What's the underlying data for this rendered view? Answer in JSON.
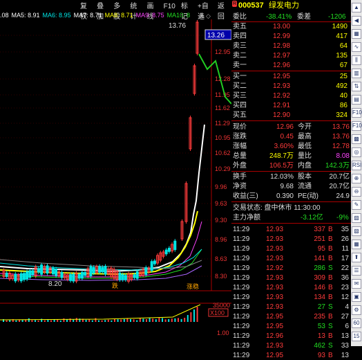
{
  "toolbar": {
    "items": [
      "复权",
      "叠加",
      "多股",
      "统计",
      "画线",
      "F10",
      "标记",
      "+自选",
      "返回"
    ]
  },
  "ma_legend": [
    {
      "label": ".08",
      "color": "#ffffff"
    },
    {
      "label": "MA5: 8.91",
      "color": "#ffffff"
    },
    {
      "label": "MA6: 8.95",
      "color": "#00e5e5"
    },
    {
      "label": "MA7: 8.71",
      "color": "#ffffff"
    },
    {
      "label": "MA8: 8.71",
      "color": "#ffff00"
    },
    {
      "label": "MA9: 8.75",
      "color": "#ff44ff"
    },
    {
      "label": "MA10: 8",
      "color": "#22dd22"
    }
  ],
  "chart": {
    "y_labels": [
      "13.26",
      "12.95",
      "12.28",
      "11.95",
      "11.62",
      "11.29",
      "10.95",
      "10.62",
      "10.29",
      "9.96",
      "9.63",
      "9.30",
      "8.96",
      "8.63",
      "8.30"
    ],
    "high_label": "13.76",
    "current_price_tag": "13.26",
    "low_label": "8.20",
    "event_label_1": "跌",
    "event_label_2": "涨稳",
    "volume_labels": [
      "35000",
      "X100",
      "1.00"
    ],
    "zoom_icons": "⊕ ◇"
  },
  "quote": {
    "code": "000537",
    "name": "绿发电力",
    "r_badge": "R",
    "weibi_label": "委比",
    "weibi_value": "-38.41%",
    "weicha_label": "委差",
    "weicha_value": "-1206",
    "asks": [
      {
        "label": "卖五",
        "price": "13.00",
        "vol": "1490"
      },
      {
        "label": "卖四",
        "price": "12.99",
        "vol": "417"
      },
      {
        "label": "卖三",
        "price": "12.98",
        "vol": "64"
      },
      {
        "label": "卖二",
        "price": "12.97",
        "vol": "135"
      },
      {
        "label": "卖一",
        "price": "12.96",
        "vol": "67"
      }
    ],
    "bids": [
      {
        "label": "买一",
        "price": "12.95",
        "vol": "25"
      },
      {
        "label": "买二",
        "price": "12.93",
        "vol": "492"
      },
      {
        "label": "买三",
        "price": "12.92",
        "vol": "40"
      },
      {
        "label": "买四",
        "price": "12.91",
        "vol": "86"
      },
      {
        "label": "买五",
        "price": "12.90",
        "vol": "324"
      }
    ],
    "stats": [
      {
        "l1": "现价",
        "v1": "12.96",
        "l2": "今开",
        "v2": "13.76",
        "c1": "red",
        "c2": "red"
      },
      {
        "l1": "涨跌",
        "v1": "0.45",
        "l2": "最高",
        "v2": "13.76",
        "c1": "red",
        "c2": "red"
      },
      {
        "l1": "涨幅",
        "v1": "3.60%",
        "l2": "最低",
        "v2": "12.78",
        "c1": "red",
        "c2": "red"
      },
      {
        "l1": "总量",
        "v1": "248.7万",
        "l2": "量比",
        "v2": "8.08",
        "c1": "yellow",
        "c2": "magenta"
      },
      {
        "l1": "外盘",
        "v1": "106.5万",
        "l2": "内盘",
        "v2": "142.3万",
        "c1": "red",
        "c2": "green"
      },
      {
        "l1": "换手",
        "v1": "12.03%",
        "l2": "股本",
        "v2": "20.7亿",
        "c1": "white",
        "c2": "white"
      },
      {
        "l1": "净资",
        "v1": "9.68",
        "l2": "流通",
        "v2": "20.7亿",
        "c1": "white",
        "c2": "white"
      },
      {
        "l1": "收益(三)",
        "v1": "0.390",
        "l2": "PE(动)",
        "v2": "24.9",
        "c1": "white",
        "c2": "white"
      }
    ],
    "trade_status": "交易状态: 盘中休市 11:30:00",
    "net_flow_label": "主力净额",
    "net_flow_value": "-3.12亿",
    "net_flow_pct": "-9%",
    "ticks": [
      {
        "t": "11:29",
        "p": "12.93",
        "v": "337",
        "s": "B",
        "n": "35"
      },
      {
        "t": "11:29",
        "p": "12.93",
        "v": "251",
        "s": "B",
        "n": "26"
      },
      {
        "t": "11:29",
        "p": "12.93",
        "v": "95",
        "s": "B",
        "n": "11"
      },
      {
        "t": "11:29",
        "p": "12.93",
        "v": "141",
        "s": "B",
        "n": "17"
      },
      {
        "t": "11:29",
        "p": "12.92",
        "v": "286",
        "s": "S",
        "n": "22"
      },
      {
        "t": "11:29",
        "p": "12.93",
        "v": "309",
        "s": "B",
        "n": "36"
      },
      {
        "t": "11:29",
        "p": "12.93",
        "v": "146",
        "s": "B",
        "n": "23"
      },
      {
        "t": "11:29",
        "p": "12.93",
        "v": "134",
        "s": "B",
        "n": "12"
      },
      {
        "t": "11:29",
        "p": "12.93",
        "v": "27",
        "s": "S",
        "n": "4"
      },
      {
        "t": "11:29",
        "p": "12.95",
        "v": "235",
        "s": "B",
        "n": "27"
      },
      {
        "t": "11:29",
        "p": "12.95",
        "v": "53",
        "s": "S",
        "n": "6"
      },
      {
        "t": "11:29",
        "p": "12.96",
        "v": "13",
        "s": "B",
        "n": "13"
      },
      {
        "t": "11:29",
        "p": "12.93",
        "v": "462",
        "s": "S",
        "n": "33"
      },
      {
        "t": "11:29",
        "p": "12.95",
        "v": "93",
        "s": "B",
        "n": "13"
      }
    ]
  },
  "side_icons": [
    "pin-icon",
    "back-icon",
    "grid-icon",
    "chart-line-icon",
    "candle-icon",
    "bar-icon",
    "flow-icon",
    "table-icon",
    "f10-icon",
    "f10b-icon",
    "heat-icon",
    "globe-icon",
    "rsi-icon",
    "zoom-in-icon",
    "zoom-out-icon",
    "tool-icon",
    "chart2-icon",
    "chart3-icon",
    "chart4-icon",
    "up-icon",
    "list-icon",
    "news-icon",
    "cal-icon",
    "gear-icon",
    "60-icon",
    "15-icon"
  ],
  "side_icon_labels": [
    "▲",
    "◀",
    "▦",
    "∿",
    "⫼",
    "▥",
    "⇅",
    "▤",
    "F10",
    "F10",
    "▩",
    "◎",
    "RSI",
    "⊕",
    "⊖",
    "✎",
    "▨",
    "▧",
    "▦",
    "⬆",
    "☰",
    "✉",
    "▣",
    "⚙",
    "60",
    "15"
  ]
}
